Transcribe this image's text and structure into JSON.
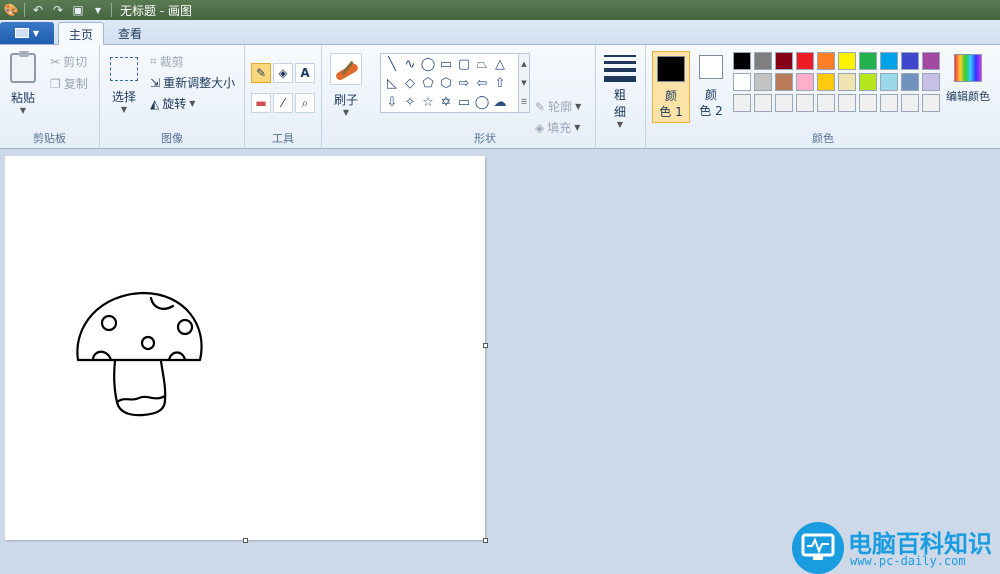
{
  "window": {
    "title": "无标题 - 画图"
  },
  "tabs": [
    {
      "label": "主页",
      "active": true
    },
    {
      "label": "查看",
      "active": false
    }
  ],
  "groups": {
    "clipboard": {
      "label": "剪贴板",
      "paste": "粘贴",
      "cut": "剪切",
      "copy": "复制"
    },
    "image": {
      "label": "图像",
      "select": "选择",
      "crop": "裁剪",
      "resize": "重新调整大小",
      "rotate": "旋转"
    },
    "tools": {
      "label": "工具"
    },
    "brushes": {
      "label": "刷子"
    },
    "shapes": {
      "label": "形状",
      "outline": "轮廓",
      "fill": "填充"
    },
    "size": {
      "label_top": "粗",
      "label_bottom": "细"
    },
    "colors": {
      "label": "颜色",
      "color1": {
        "line1": "颜",
        "line2": "色 1",
        "value": "#000000"
      },
      "color2": {
        "line1": "颜",
        "line2": "色 2",
        "value": "#ffffff"
      },
      "edit": "编辑颜色",
      "palette_row1": [
        "#000000",
        "#7f7f7f",
        "#880015",
        "#ed1c24",
        "#ff7f27",
        "#fff200",
        "#22b14c",
        "#00a2e8",
        "#3f48cc",
        "#a349a4"
      ],
      "palette_row2": [
        "#ffffff",
        "#c3c3c3",
        "#b97a57",
        "#ffaec9",
        "#ffc90e",
        "#efe4b0",
        "#b5e61d",
        "#99d9ea",
        "#7092be",
        "#c8bfe7"
      ],
      "palette_row3": [
        "#f0f0f0",
        "#f0f0f0",
        "#f0f0f0",
        "#f0f0f0",
        "#f0f0f0",
        "#f0f0f0",
        "#f0f0f0",
        "#f0f0f0",
        "#f0f0f0",
        "#f0f0f0"
      ]
    }
  },
  "watermark": {
    "name": "电脑百科知识",
    "url": "www.pc-daily.com"
  }
}
